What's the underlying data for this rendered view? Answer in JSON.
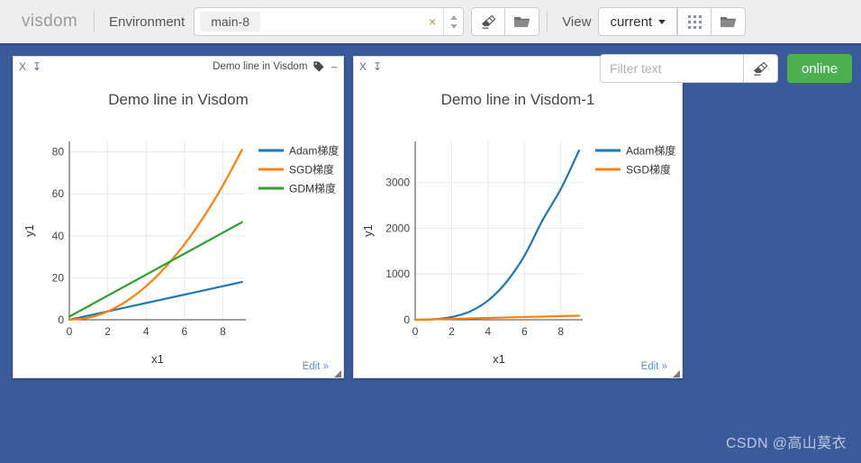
{
  "toolbar": {
    "brand": "visdom",
    "environment_label": "Environment",
    "env_tag": "main-8",
    "env_clear": "×",
    "eraser_button": "eraser-icon",
    "folder_button": "folder-icon",
    "view_label": "View",
    "view_value": "current",
    "grid_button": "grid-icon",
    "view_folder_button": "folder-icon"
  },
  "filter": {
    "placeholder": "Filter text",
    "value": "",
    "clear_button": "eraser-icon"
  },
  "status": {
    "connection": "online",
    "connection_color": "#4caf50"
  },
  "panels": [
    {
      "close_icon": "X",
      "download_icon": "↧",
      "header_title": "Demo line in Visdom",
      "tag_icon": "tag-icon",
      "wave_icon": "~",
      "edit_link": "Edit »"
    },
    {
      "close_icon": "X",
      "download_icon": "↧",
      "header_title": "Demo line in",
      "edit_link": "Edit »"
    }
  ],
  "watermark": "CSDN @高山莫衣",
  "chart_data": [
    {
      "type": "line",
      "title": "Demo line in Visdom",
      "xlabel": "x1",
      "ylabel": "y1",
      "xlim": [
        0,
        9.2
      ],
      "ylim": [
        0,
        85
      ],
      "xticks": [
        0,
        2,
        4,
        6,
        8
      ],
      "yticks": [
        0,
        20,
        40,
        60,
        80
      ],
      "grid": true,
      "legend_position": "right",
      "x": [
        0,
        1,
        2,
        3,
        4,
        5,
        6,
        7,
        8,
        9
      ],
      "series": [
        {
          "name": "Adam梯度",
          "color": "#1f77b4",
          "values": [
            0,
            2,
            4,
            6,
            8,
            10,
            12,
            14,
            16,
            18
          ]
        },
        {
          "name": "SGD梯度",
          "color": "#ff7f0e",
          "values": [
            0,
            1,
            4,
            9,
            16,
            25,
            36,
            49,
            64,
            81
          ]
        },
        {
          "name": "GDM梯度",
          "color": "#2ca02c",
          "values": [
            1.5,
            6.5,
            11.5,
            16.5,
            21.5,
            26.5,
            31.5,
            36.5,
            41.5,
            46.5
          ]
        }
      ]
    },
    {
      "type": "line",
      "title": "Demo line in Visdom-1",
      "xlabel": "x1",
      "ylabel": "y1",
      "xlim": [
        0,
        9.2
      ],
      "ylim": [
        0,
        3900
      ],
      "xticks": [
        0,
        2,
        4,
        6,
        8
      ],
      "yticks": [
        0,
        1000,
        2000,
        3000
      ],
      "grid": true,
      "legend_position": "right",
      "x": [
        0,
        1,
        2,
        3,
        4,
        5,
        6,
        7,
        8,
        9
      ],
      "series": [
        {
          "name": "Adam梯度",
          "color": "#1f77b4",
          "values": [
            0,
            10,
            60,
            180,
            420,
            820,
            1400,
            2180,
            2860,
            3700
          ]
        },
        {
          "name": "SGD梯度",
          "color": "#ff7f0e",
          "values": [
            0,
            10,
            20,
            30,
            40,
            50,
            60,
            70,
            80,
            90
          ]
        }
      ]
    }
  ]
}
